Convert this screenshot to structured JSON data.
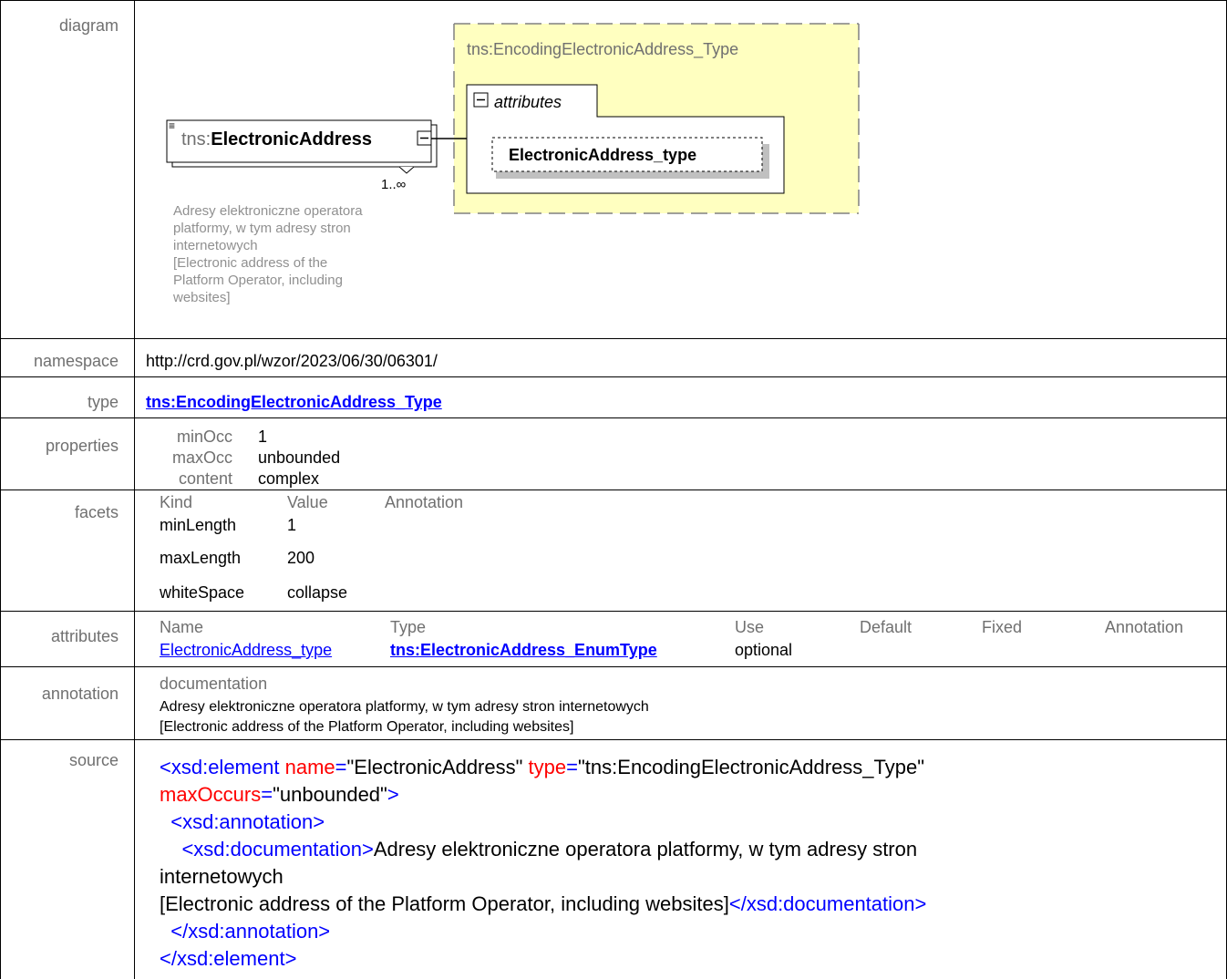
{
  "rows": {
    "diagram_label": "diagram",
    "namespace_label": "namespace",
    "type_label": "type",
    "properties_label": "properties",
    "facets_label": "facets",
    "attributes_label": "attributes",
    "annotation_label": "annotation",
    "source_label": "source"
  },
  "diagram": {
    "element_name_prefix": "tns:",
    "element_name": "ElectronicAddress",
    "cardinality": "1..∞",
    "type_box_title": "tns:EncodingElectronicAddress_Type",
    "attributes_group": "attributes",
    "attribute_name": "ElectronicAddress_type",
    "note_lines": [
      "Adresy elektroniczne operatora",
      "platformy, w tym adresy stron",
      "internetowych",
      "[Electronic address of the",
      "Platform Operator, including",
      "websites]"
    ]
  },
  "namespace": "http://crd.gov.pl/wzor/2023/06/30/06301/",
  "type": "tns:EncodingElectronicAddress_Type",
  "properties": {
    "minOcc_label": "minOcc",
    "minOcc": "1",
    "maxOcc_label": "maxOcc",
    "maxOcc": "unbounded",
    "content_label": "content",
    "content": "complex"
  },
  "facets": {
    "headers": [
      "Kind",
      "Value",
      "Annotation"
    ],
    "rows": [
      {
        "kind": "minLength",
        "value": "1"
      },
      {
        "kind": "maxLength",
        "value": "200"
      },
      {
        "kind": "whiteSpace",
        "value": "collapse"
      }
    ]
  },
  "attributes": {
    "headers": [
      "Name",
      "Type",
      "Use",
      "Default",
      "Fixed",
      "Annotation"
    ],
    "row": {
      "name": "ElectronicAddress_type",
      "type": "tns:ElectronicAddress_EnumType",
      "use": "optional"
    }
  },
  "annotation": {
    "heading": "documentation",
    "line1": "Adresy elektroniczne operatora platformy, w tym adresy stron internetowych",
    "line2": "[Electronic address of the Platform Operator, including websites]"
  },
  "source": {
    "l1_open": "<xsd:element",
    "l1_attr1": "name",
    "l1_val1": "\"ElectronicAddress\"",
    "l1_attr2": "type",
    "l1_val2": "\"tns:EncodingElectronicAddress_Type\"",
    "l2_attr": "maxOccurs",
    "l2_val": "\"unbounded\"",
    "l3": "<xsd:annotation>",
    "l4_tag": "<xsd:documentation>",
    "l4_text": "Adresy elektroniczne operatora platformy, w tym adresy stron",
    "l5_text": "internetowych",
    "l6_text": "[Electronic address of the Platform Operator, including websites]",
    "l6_close": "</xsd:documentation>",
    "l7": "</xsd:annotation>",
    "l8": "</xsd:element>"
  }
}
